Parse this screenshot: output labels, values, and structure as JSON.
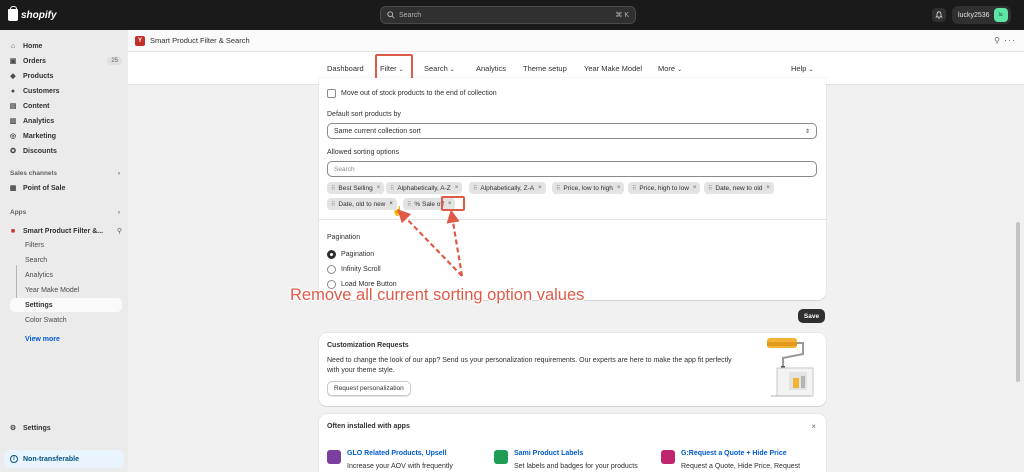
{
  "topbar": {
    "brand": "shopify",
    "search_placeholder": "Search",
    "search_shortcut": "⌘ K",
    "username": "lucky2536",
    "avatar_initials": "lu"
  },
  "sidebar": {
    "items": [
      {
        "label": "Home",
        "icon": "home-icon"
      },
      {
        "label": "Orders",
        "icon": "orders-icon",
        "badge": "25"
      },
      {
        "label": "Products",
        "icon": "tag-icon"
      },
      {
        "label": "Customers",
        "icon": "person-icon"
      },
      {
        "label": "Content",
        "icon": "content-icon"
      },
      {
        "label": "Analytics",
        "icon": "chart-icon"
      },
      {
        "label": "Marketing",
        "icon": "target-icon"
      },
      {
        "label": "Discounts",
        "icon": "discount-icon"
      }
    ],
    "sales_channels_label": "Sales channels",
    "point_of_sale": "Point of Sale",
    "apps_label": "Apps",
    "app_name": "Smart Product Filter &...",
    "app_subitems": [
      "Filters",
      "Search",
      "Analytics",
      "Year Make Model",
      "Settings",
      "Color Swatch"
    ],
    "view_more": "View more",
    "settings": "Settings",
    "non_transferable": "Non-transferable"
  },
  "appbar": {
    "title": "Smart Product Filter & Search",
    "logo_letter": "Y"
  },
  "tabs": [
    {
      "label": "Dashboard",
      "chevron": false
    },
    {
      "label": "Filter",
      "chevron": true
    },
    {
      "label": "Search",
      "chevron": true
    },
    {
      "label": "Analytics",
      "chevron": false
    },
    {
      "label": "Theme setup",
      "chevron": false
    },
    {
      "label": "Year Make Model",
      "chevron": false
    },
    {
      "label": "More",
      "chevron": true
    },
    {
      "label": "Help",
      "chevron": true
    }
  ],
  "main": {
    "out_of_stock_label": "Move out of stock products to the end of collection",
    "default_sort_label": "Default sort products by",
    "default_sort_value": "Same current collection sort",
    "allowed_sorting_label": "Allowed sorting options",
    "sorting_search_placeholder": "Search",
    "sort_chips": [
      "Best Selling",
      "Alphabetically, A-Z",
      "Alphabetically, Z-A",
      "Price, low to high",
      "Price, high to low",
      "Date, new to old",
      "Date, old to new",
      "% Sale off"
    ],
    "pagination_label": "Pagination",
    "pagination_options": [
      "Pagination",
      "Infinity Scroll",
      "Load More Button"
    ],
    "pagination_selected": "Pagination"
  },
  "annotation": "Remove all current sorting option values",
  "save_label": "Save",
  "customization": {
    "title": "Customization Requests",
    "text": "Need to change the look of our app? Send us your personalization requirements. Our experts are here to make the app fit perfectly with your theme style.",
    "button": "Request personalization"
  },
  "often": {
    "title": "Often installed with apps",
    "apps": [
      {
        "name": "GLO Related Products, Upsell",
        "desc": "Increase your AOV with frequently",
        "color": "#7b3fa0"
      },
      {
        "name": "Sami Product Labels",
        "desc": "Set labels and badges for your products",
        "color": "#1f9d55"
      },
      {
        "name": "G:Request a Quote + Hide Price",
        "desc": "Request a Quote, Hide Price, Request",
        "color": "#c0266d"
      }
    ]
  },
  "colors": {
    "accent": "#e05a48",
    "link": "#005bd3"
  }
}
